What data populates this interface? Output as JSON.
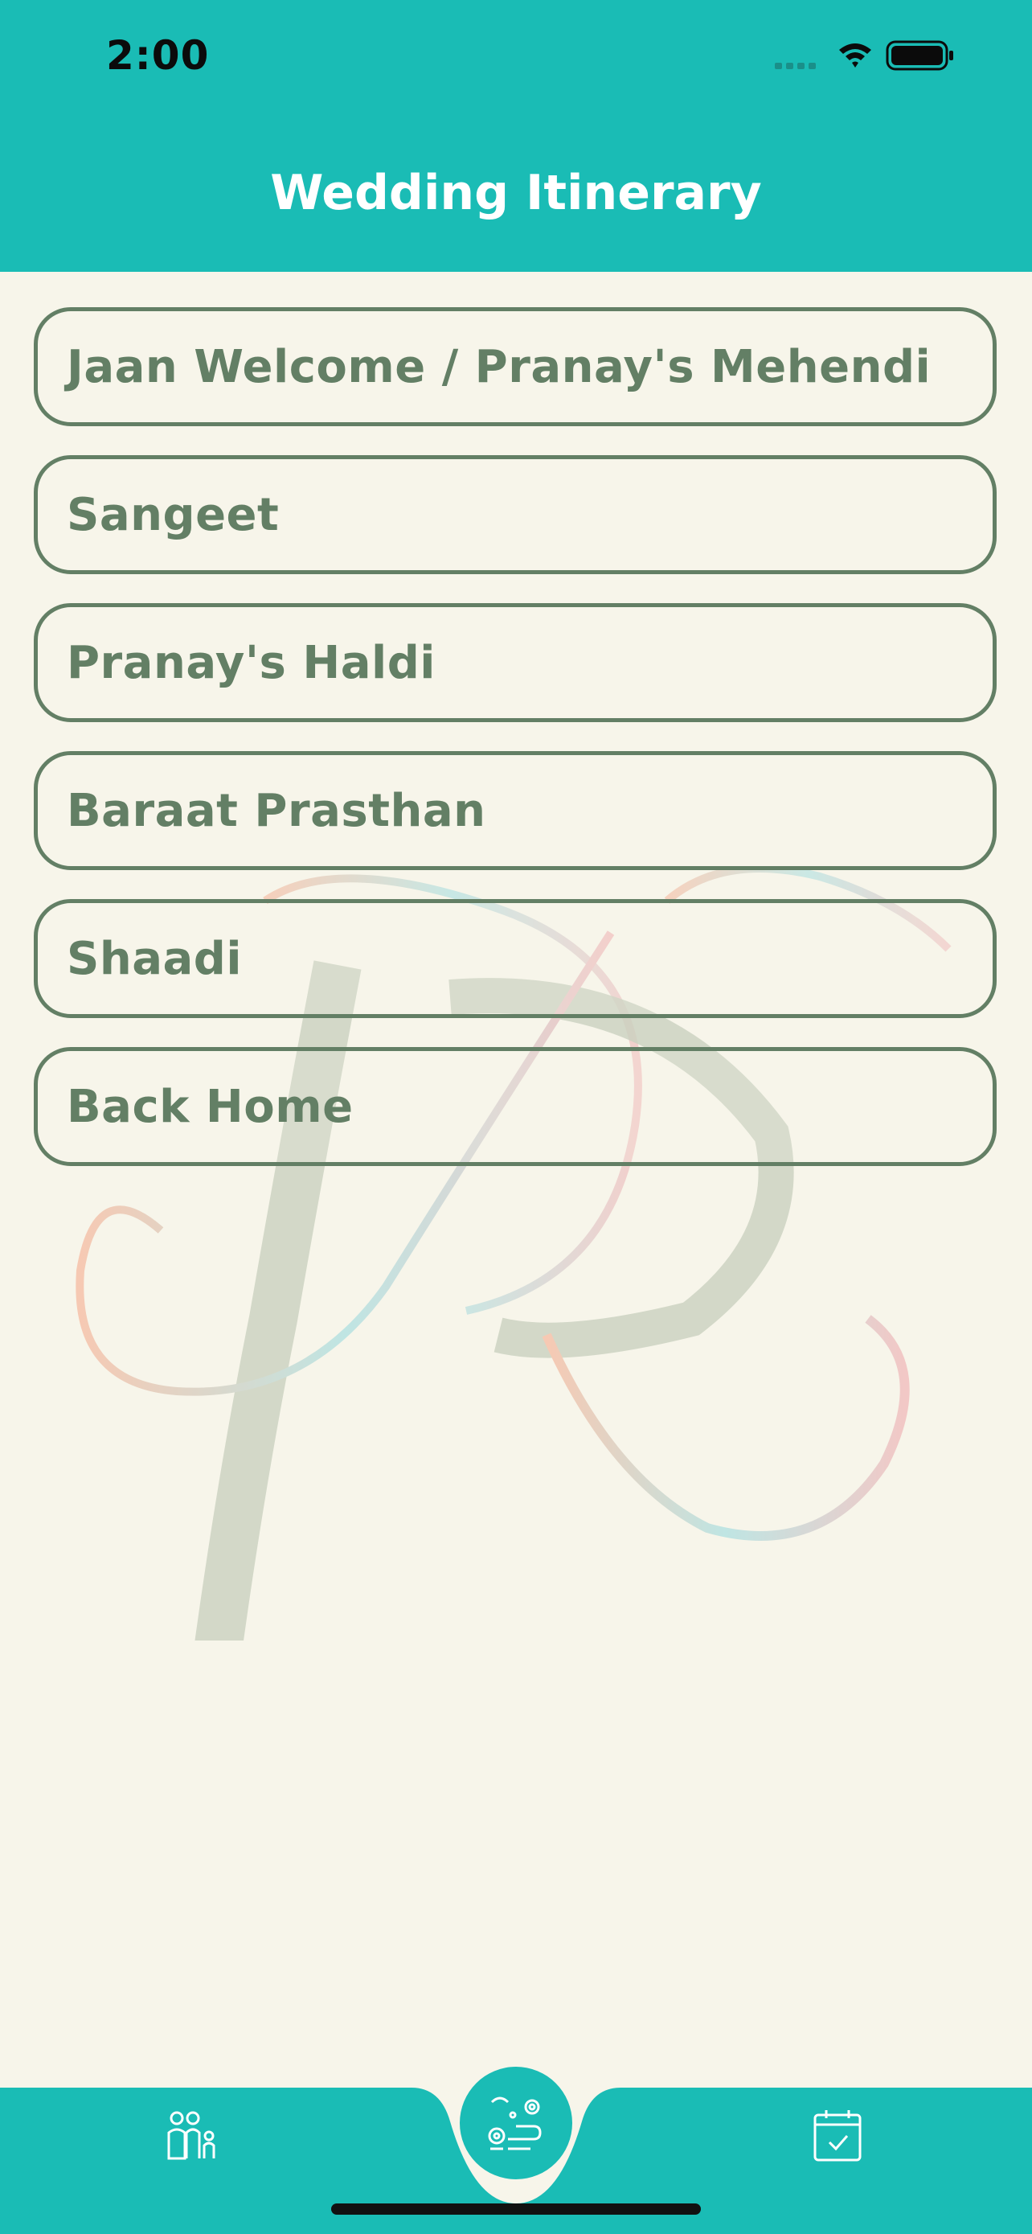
{
  "status": {
    "time": "2:00"
  },
  "header": {
    "title": "Wedding Itinerary"
  },
  "itinerary": {
    "items": [
      {
        "label": "Jaan Welcome / Pranay's Mehendi"
      },
      {
        "label": "Sangeet"
      },
      {
        "label": "Pranay's Haldi"
      },
      {
        "label": "Baraat Prasthan"
      },
      {
        "label": "Shaadi"
      },
      {
        "label": "Back Home"
      }
    ]
  },
  "tabbar": {
    "tabs": [
      {
        "icon": "family-icon"
      },
      {
        "icon": "itinerary-route-icon"
      },
      {
        "icon": "calendar-check-icon"
      }
    ]
  },
  "colors": {
    "accent": "#1abcb5",
    "text": "#637f65",
    "background": "#f7f5ea"
  }
}
